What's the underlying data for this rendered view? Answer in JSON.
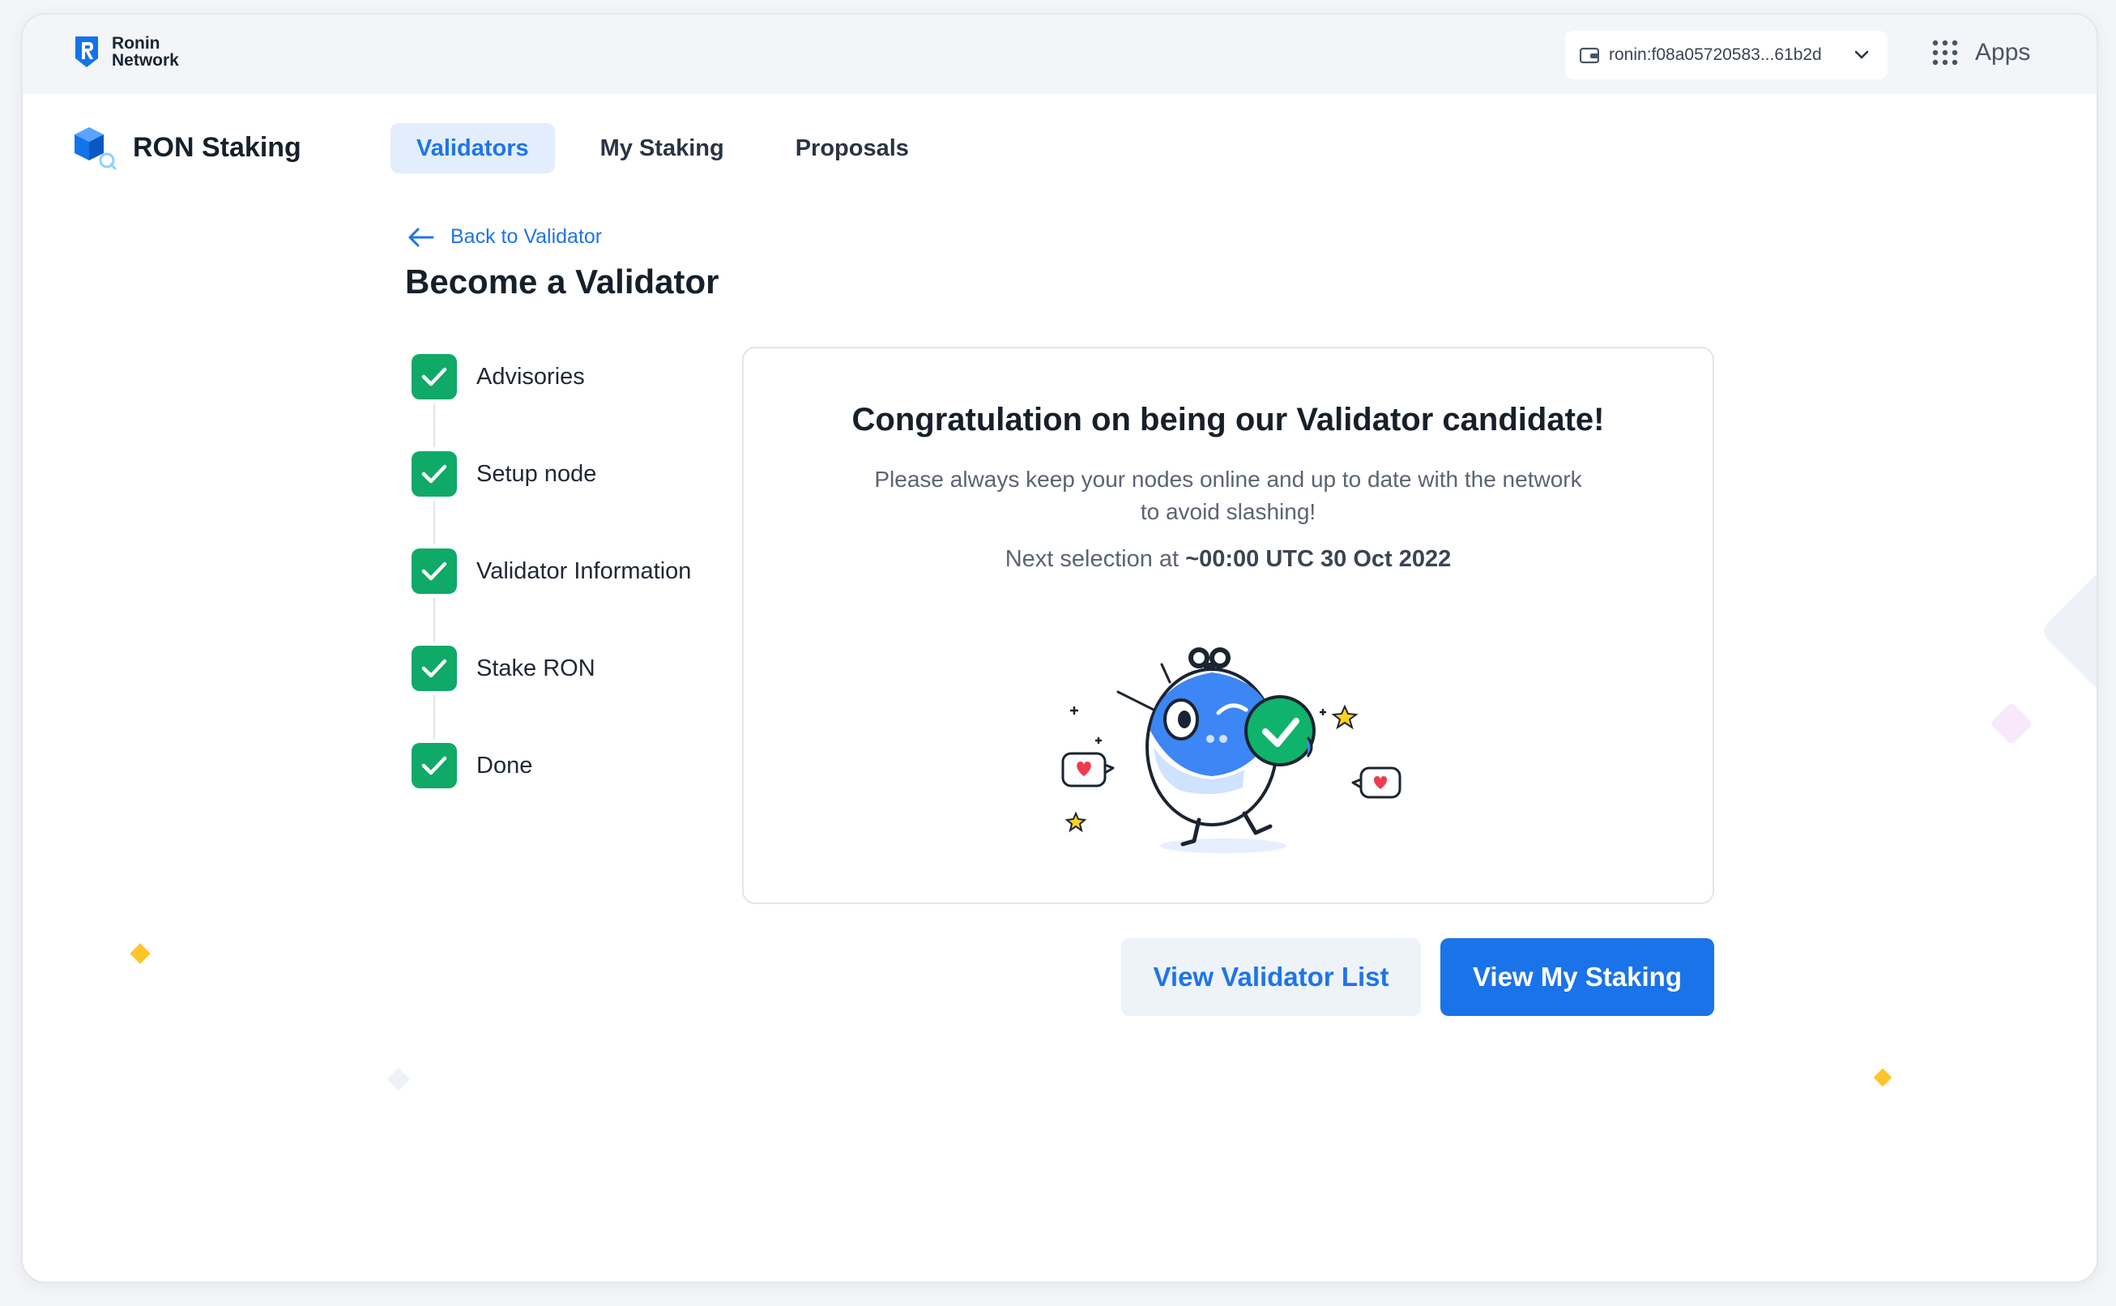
{
  "header": {
    "brand_line1": "Ronin",
    "brand_line2": "Network",
    "wallet_address": "ronin:f08a05720583...61b2d",
    "apps_label": "Apps"
  },
  "app": {
    "title": "RON Staking"
  },
  "tabs": [
    {
      "label": "Validators",
      "active": true
    },
    {
      "label": "My Staking",
      "active": false
    },
    {
      "label": "Proposals",
      "active": false
    }
  ],
  "back_link": "Back to Validator",
  "page_title": "Become a Validator",
  "steps": [
    {
      "label": "Advisories",
      "done": true
    },
    {
      "label": "Setup node",
      "done": true
    },
    {
      "label": "Validator Information",
      "done": true
    },
    {
      "label": "Stake RON",
      "done": true
    },
    {
      "label": "Done",
      "done": true
    }
  ],
  "card": {
    "title": "Congratulation on being our Validator candidate!",
    "message": "Please always keep your nodes online and up to date with the network to avoid slashing!",
    "next_prefix": "Next selection at",
    "next_value": "~00:00 UTC 30 Oct 2022"
  },
  "actions": {
    "secondary_label": "View Validator List",
    "primary_label": "View My Staking"
  },
  "colors": {
    "accent": "#1a73e8",
    "success": "#0fa968",
    "tab_active_bg": "#e3eefc"
  }
}
